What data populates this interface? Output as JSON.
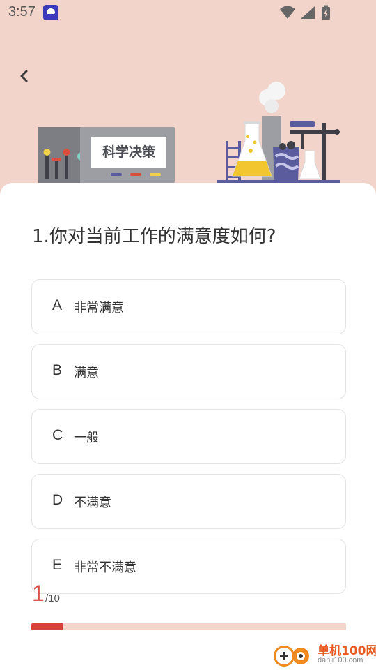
{
  "status_bar": {
    "time": "3:57"
  },
  "header": {
    "title_image_text": "科学决策"
  },
  "question": {
    "text": "1.你对当前工作的满意度如何?"
  },
  "options": [
    {
      "letter": "A",
      "label": "非常满意"
    },
    {
      "letter": "B",
      "label": "满意"
    },
    {
      "letter": "C",
      "label": "一般"
    },
    {
      "letter": "D",
      "label": "不满意"
    },
    {
      "letter": "E",
      "label": "非常不满意"
    }
  ],
  "progress": {
    "current": "1",
    "total": "/10",
    "fraction": 0.1
  },
  "watermark": {
    "name": "单机100网",
    "url": "danji100.com"
  },
  "colors": {
    "background": "#f2d4ca",
    "accent": "#d8403a",
    "progress_track": "#f3d5cc"
  },
  "icons": [
    "back-arrow",
    "wifi",
    "signal",
    "battery-charging"
  ]
}
